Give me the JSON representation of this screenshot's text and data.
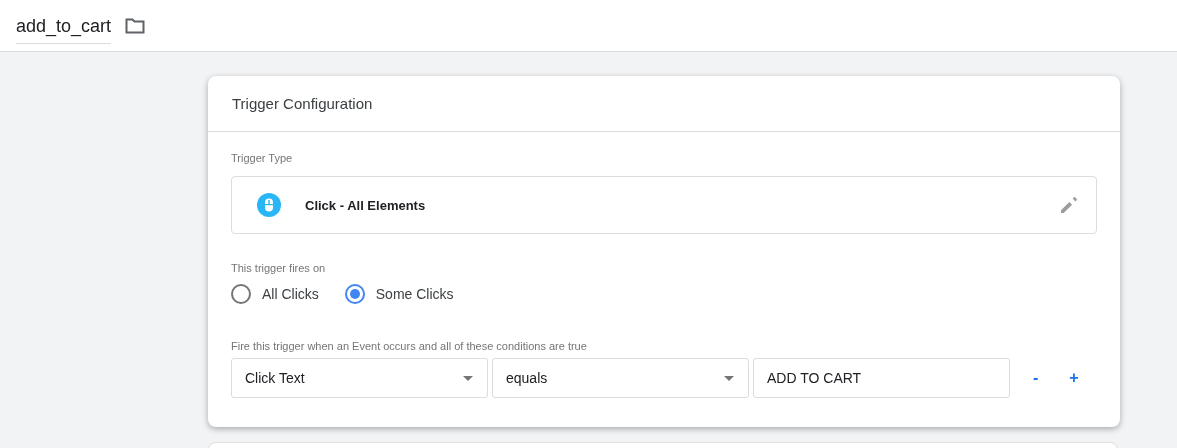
{
  "header": {
    "name": "add_to_cart"
  },
  "card": {
    "title": "Trigger Configuration",
    "trigger_type": {
      "label": "Trigger Type",
      "name": "Click - All Elements"
    },
    "fires_on": {
      "label": "This trigger fires on",
      "options": [
        {
          "label": "All Clicks",
          "selected": false
        },
        {
          "label": "Some Clicks",
          "selected": true
        }
      ]
    },
    "conditions": {
      "label": "Fire this trigger when an Event occurs and all of these conditions are true",
      "rows": [
        {
          "fields": [
            {
              "kind": "dropdown",
              "value": "Click Text"
            },
            {
              "kind": "dropdown",
              "value": "equals"
            },
            {
              "kind": "text",
              "value": "ADD TO CART"
            }
          ],
          "remove": "-",
          "add": "+"
        }
      ]
    }
  }
}
